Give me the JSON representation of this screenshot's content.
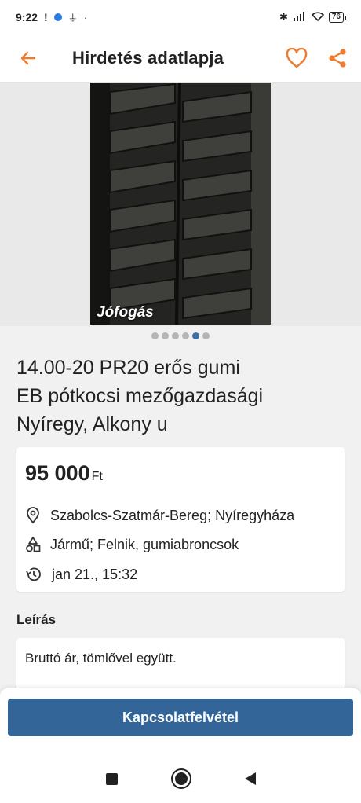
{
  "status_bar": {
    "time": "9:22",
    "battery": "76"
  },
  "header": {
    "title": "Hirdetés adatlapja"
  },
  "photo": {
    "watermark": "Jófogás",
    "count": 6,
    "active_index": 4
  },
  "ad": {
    "title_lines": [
      "14.00-20 PR20 erős gumi",
      "EB pótkocsi mezőgazdasági",
      "Nyíregy, Alkony u"
    ],
    "price": "95 000",
    "currency": "Ft",
    "location": "Szabolcs-Szatmár-Bereg; Nyíregyháza",
    "category": "Jármű; Felnik, gumiabroncsok",
    "date": "jan 21., 15:32"
  },
  "description": {
    "label": "Leírás",
    "text": "Bruttó ár, tömlővel együtt."
  },
  "actions": {
    "contact_label": "Kapcsolatfelvétel"
  },
  "colors": {
    "accent": "#f07a2e",
    "primary": "#336598",
    "dot_active": "#3a6ea5"
  }
}
